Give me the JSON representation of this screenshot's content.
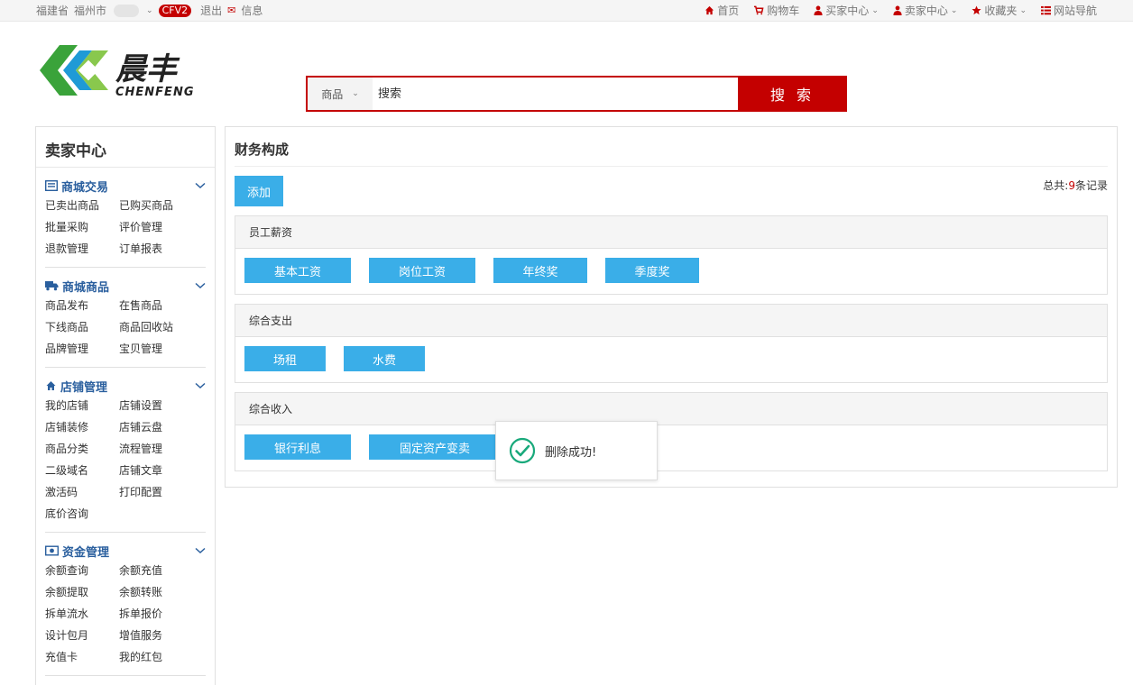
{
  "topbar": {
    "province": "福建省",
    "city": "福州市",
    "badge": "CFV2",
    "logout": "退出",
    "message": "信息",
    "right": [
      {
        "icon": "home-icon",
        "label": "首页"
      },
      {
        "icon": "cart-icon",
        "label": "购物车"
      },
      {
        "icon": "user-icon",
        "label": "买家中心",
        "dropdown": true
      },
      {
        "icon": "user-icon",
        "label": "卖家中心",
        "dropdown": true
      },
      {
        "icon": "star-icon",
        "label": "收藏夹",
        "dropdown": true
      },
      {
        "icon": "list-icon",
        "label": "网站导航"
      }
    ]
  },
  "header": {
    "logo_text": "晨丰",
    "logo_sub": "CHENFENG",
    "search_category": "商品",
    "search_placeholder": "搜索",
    "search_button": "搜 索"
  },
  "sidebar": {
    "title": "卖家中心",
    "groups": [
      {
        "title": "商城交易",
        "icon": "list-icon",
        "links": [
          "已卖出商品",
          "已购买商品",
          "批量采购",
          "评价管理",
          "退款管理",
          "订单报表"
        ]
      },
      {
        "title": "商城商品",
        "icon": "truck-icon",
        "links": [
          "商品发布",
          "在售商品",
          "下线商品",
          "商品回收站",
          "品牌管理",
          "宝贝管理"
        ]
      },
      {
        "title": "店铺管理",
        "icon": "home-icon",
        "links": [
          "我的店铺",
          "店铺设置",
          "店铺装修",
          "店铺云盘",
          "商品分类",
          "流程管理",
          "二级域名",
          "店铺文章",
          "激活码",
          "打印配置",
          "底价咨询"
        ]
      },
      {
        "title": "资金管理",
        "icon": "money-icon",
        "links": [
          "余额查询",
          "余额充值",
          "余额提取",
          "余额转账",
          "拆单流水",
          "拆单报价",
          "设计包月",
          "增值服务",
          "充值卡",
          "我的红包"
        ]
      }
    ]
  },
  "main": {
    "title": "财务构成",
    "add_button": "添加",
    "total_prefix": "总共:",
    "total_count": "9",
    "total_suffix": "条记录",
    "panels": [
      {
        "title": "员工薪资",
        "items": [
          {
            "label": "基本工资",
            "w": 118
          },
          {
            "label": "岗位工资",
            "w": 118
          },
          {
            "label": "年终奖",
            "w": 104
          },
          {
            "label": "季度奖",
            "w": 104
          }
        ]
      },
      {
        "title": "综合支出",
        "items": [
          {
            "label": "场租",
            "w": 90
          },
          {
            "label": "水费",
            "w": 90
          }
        ]
      },
      {
        "title": "综合收入",
        "items": [
          {
            "label": "银行利息",
            "w": 118
          },
          {
            "label": "固定资产变卖",
            "w": 146
          }
        ]
      }
    ]
  },
  "toast": {
    "text": "删除成功!",
    "icon": "check-circle-icon",
    "color": "#19a97b"
  },
  "colors": {
    "brand_red": "#c40000",
    "accent_blue": "#3aaee8",
    "link_blue": "#2a5f9e"
  }
}
